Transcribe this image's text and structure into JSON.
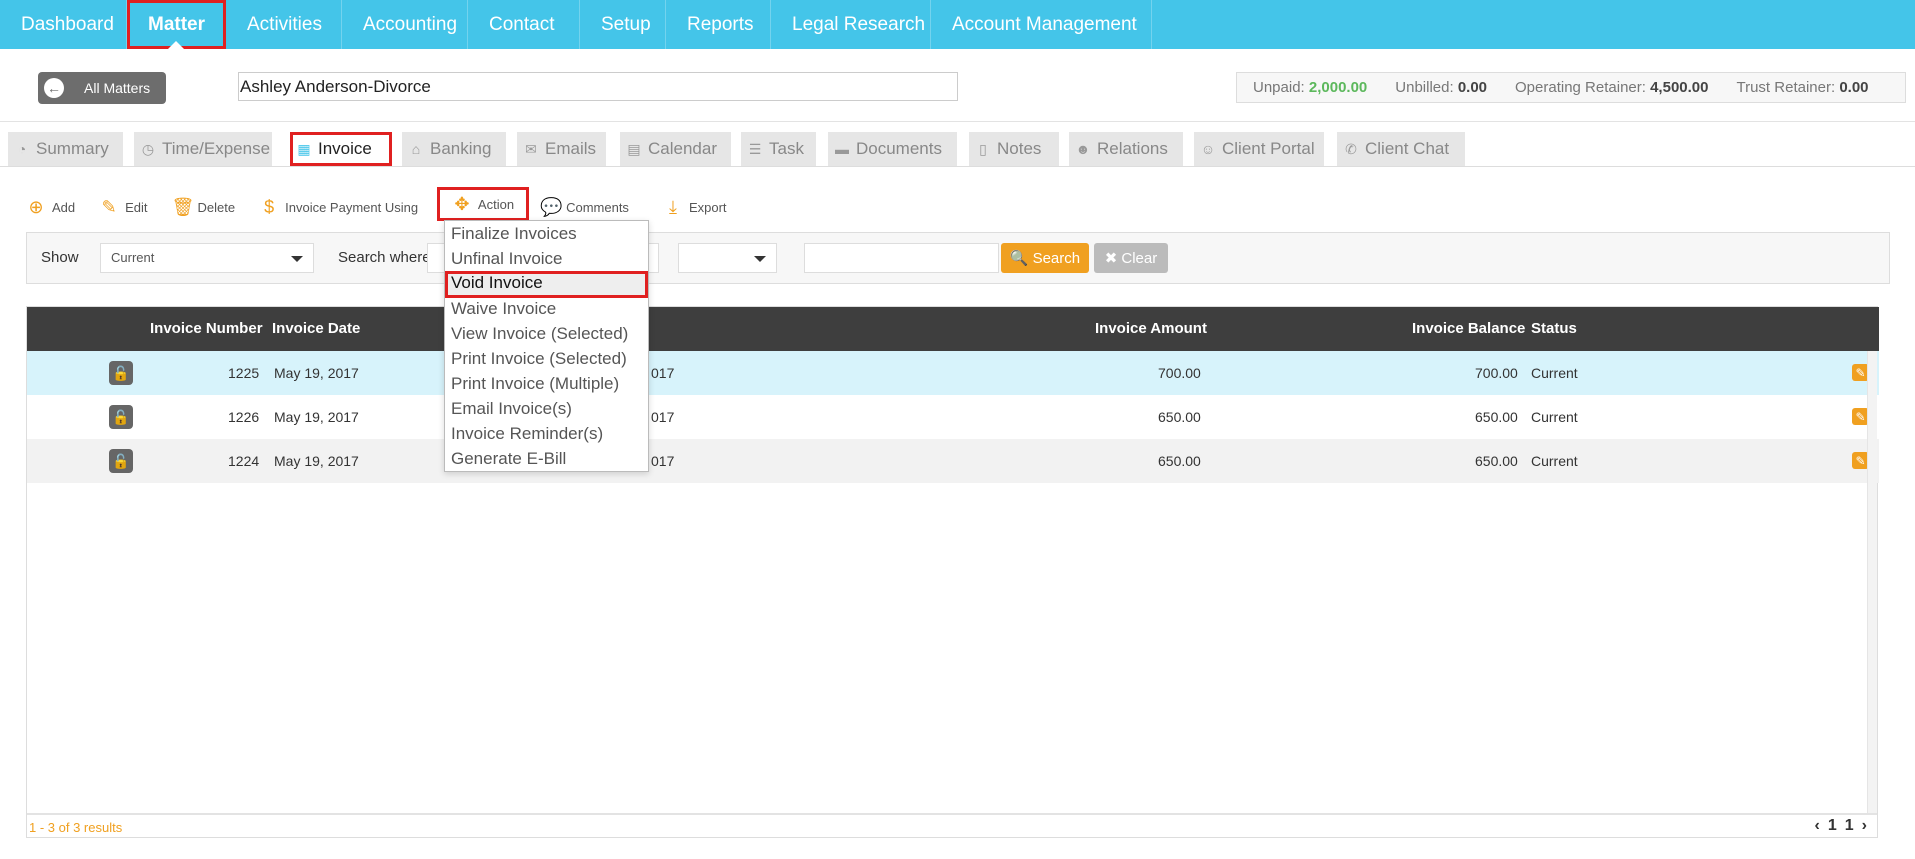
{
  "nav": {
    "items": [
      {
        "label": "Dashboard"
      },
      {
        "label": "Matter"
      },
      {
        "label": "Activities"
      },
      {
        "label": "Accounting"
      },
      {
        "label": "Contact"
      },
      {
        "label": "Setup"
      },
      {
        "label": "Reports"
      },
      {
        "label": "Legal Research"
      },
      {
        "label": "Account Management"
      }
    ]
  },
  "matter": {
    "back_label": "All Matters",
    "name": "Ashley Anderson-Divorce",
    "balances": {
      "unpaid_label": "Unpaid:",
      "unpaid_value": "2,000.00",
      "unbilled_label": "Unbilled:",
      "unbilled_value": "0.00",
      "op_label": "Operating Retainer:",
      "op_value": "4,500.00",
      "trust_label": "Trust Retainer:",
      "trust_value": "0.00"
    }
  },
  "tabs": [
    {
      "label": "Summary"
    },
    {
      "label": "Time/Expense"
    },
    {
      "label": "Invoice"
    },
    {
      "label": "Banking"
    },
    {
      "label": "Emails"
    },
    {
      "label": "Calendar"
    },
    {
      "label": "Task"
    },
    {
      "label": "Documents"
    },
    {
      "label": "Notes"
    },
    {
      "label": "Relations"
    },
    {
      "label": "Client Portal"
    },
    {
      "label": "Client Chat"
    }
  ],
  "toolbar": {
    "add": "Add",
    "edit": "Edit",
    "delete": "Delete",
    "payment": "Invoice Payment Using",
    "action": "Action",
    "comments": "Comments",
    "export": "Export"
  },
  "filter": {
    "show_label": "Show",
    "show_value": "Current",
    "search_where_label": "Search where",
    "search_button": "Search",
    "clear_button": "Clear"
  },
  "grid": {
    "headers": {
      "number": "Invoice Number",
      "date": "Invoice Date",
      "amount": "Invoice Amount",
      "balance": "Invoice Balance",
      "status": "Status"
    },
    "rows": [
      {
        "number": "1225",
        "date": "May 19, 2017",
        "date2_tail": "017",
        "amount": "700.00",
        "balance": "700.00",
        "status": "Current"
      },
      {
        "number": "1226",
        "date": "May 19, 2017",
        "date2_tail": "017",
        "amount": "650.00",
        "balance": "650.00",
        "status": "Current"
      },
      {
        "number": "1224",
        "date": "May 19, 2017",
        "date2_tail": "017",
        "amount": "650.00",
        "balance": "650.00",
        "status": "Current"
      }
    ],
    "footer_count": "1 - 3 of 3 results",
    "pager": {
      "prev": "‹",
      "page": "1",
      "total": "1",
      "next": "›"
    }
  },
  "action_menu": {
    "items": [
      {
        "label": "Finalize Invoices"
      },
      {
        "label": "Unfinal Invoice"
      },
      {
        "label": "Void Invoice"
      },
      {
        "label": "Waive Invoice"
      },
      {
        "label": "View Invoice (Selected)"
      },
      {
        "label": "Print Invoice (Selected)"
      },
      {
        "label": "Print Invoice (Multiple)"
      },
      {
        "label": "Email Invoice(s)"
      },
      {
        "label": "Invoice Reminder(s)"
      },
      {
        "label": "Generate E-Bill"
      }
    ]
  },
  "colors": {
    "nav_bg": "#44c5e9",
    "accent": "#f0a020",
    "highlight": "#e02020",
    "header_bg": "#3e3e3e",
    "selected_row": "#d7f3fb"
  }
}
